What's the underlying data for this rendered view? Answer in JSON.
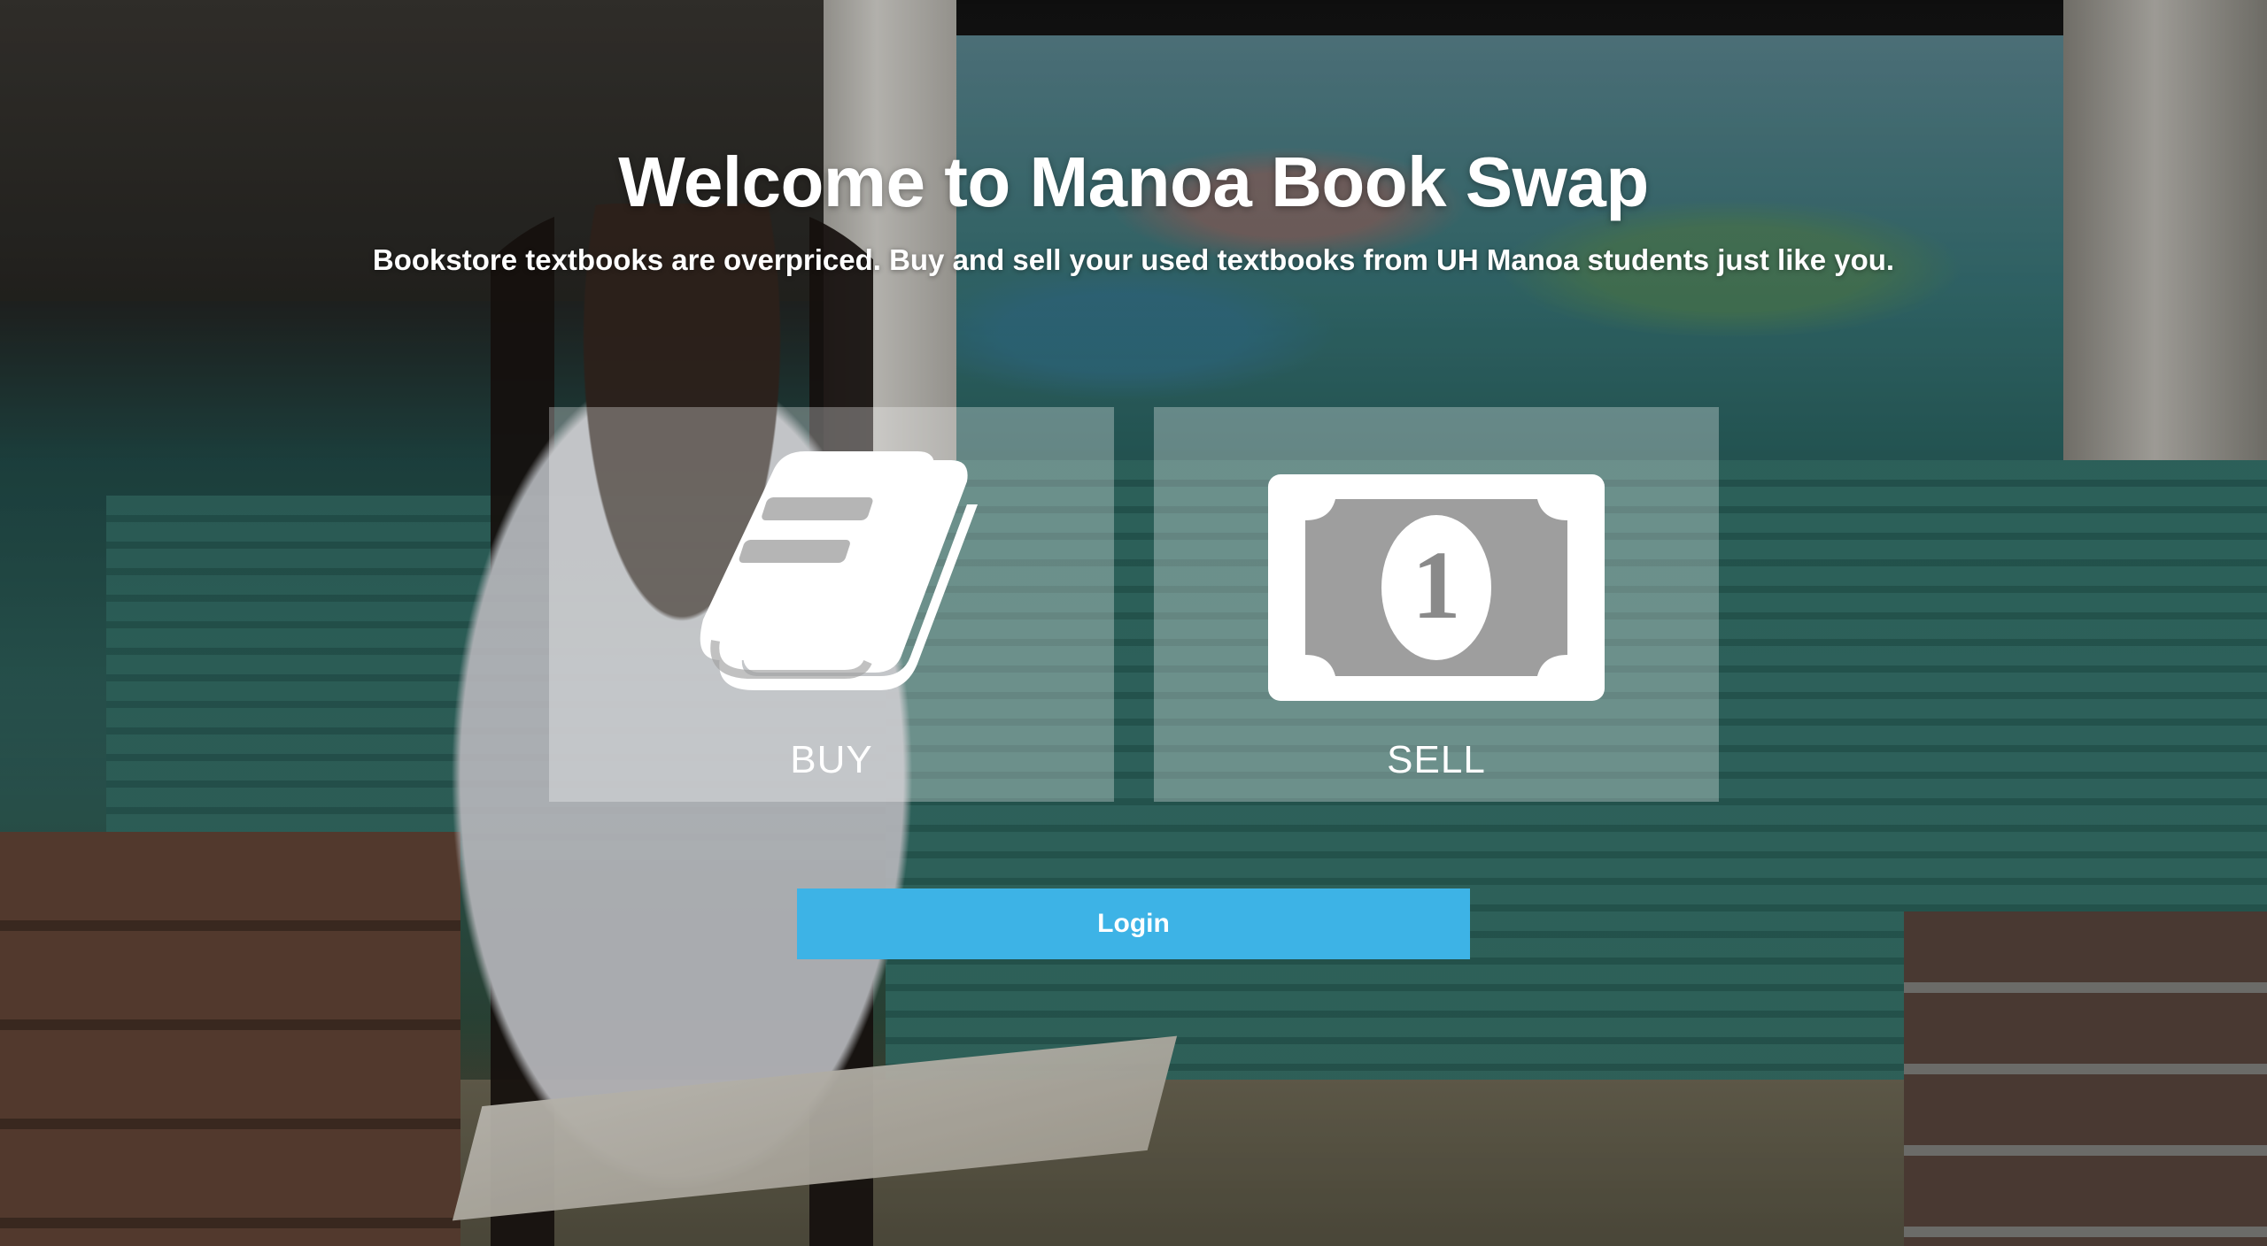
{
  "hero": {
    "title": "Welcome to Manoa Book Swap",
    "subtitle": "Bookstore textbooks are overpriced. Buy and sell your used textbooks from UH Manoa students just like you."
  },
  "actions": {
    "buy": {
      "label": "BUY",
      "icon": "book-icon"
    },
    "sell": {
      "label": "SELL",
      "icon": "dollar-bill-icon",
      "bill_value": "1"
    }
  },
  "login": {
    "label": "Login"
  },
  "colors": {
    "login_button": "#3db3e6",
    "card_overlay": "rgba(255,255,255,0.3)",
    "text": "#ffffff"
  }
}
